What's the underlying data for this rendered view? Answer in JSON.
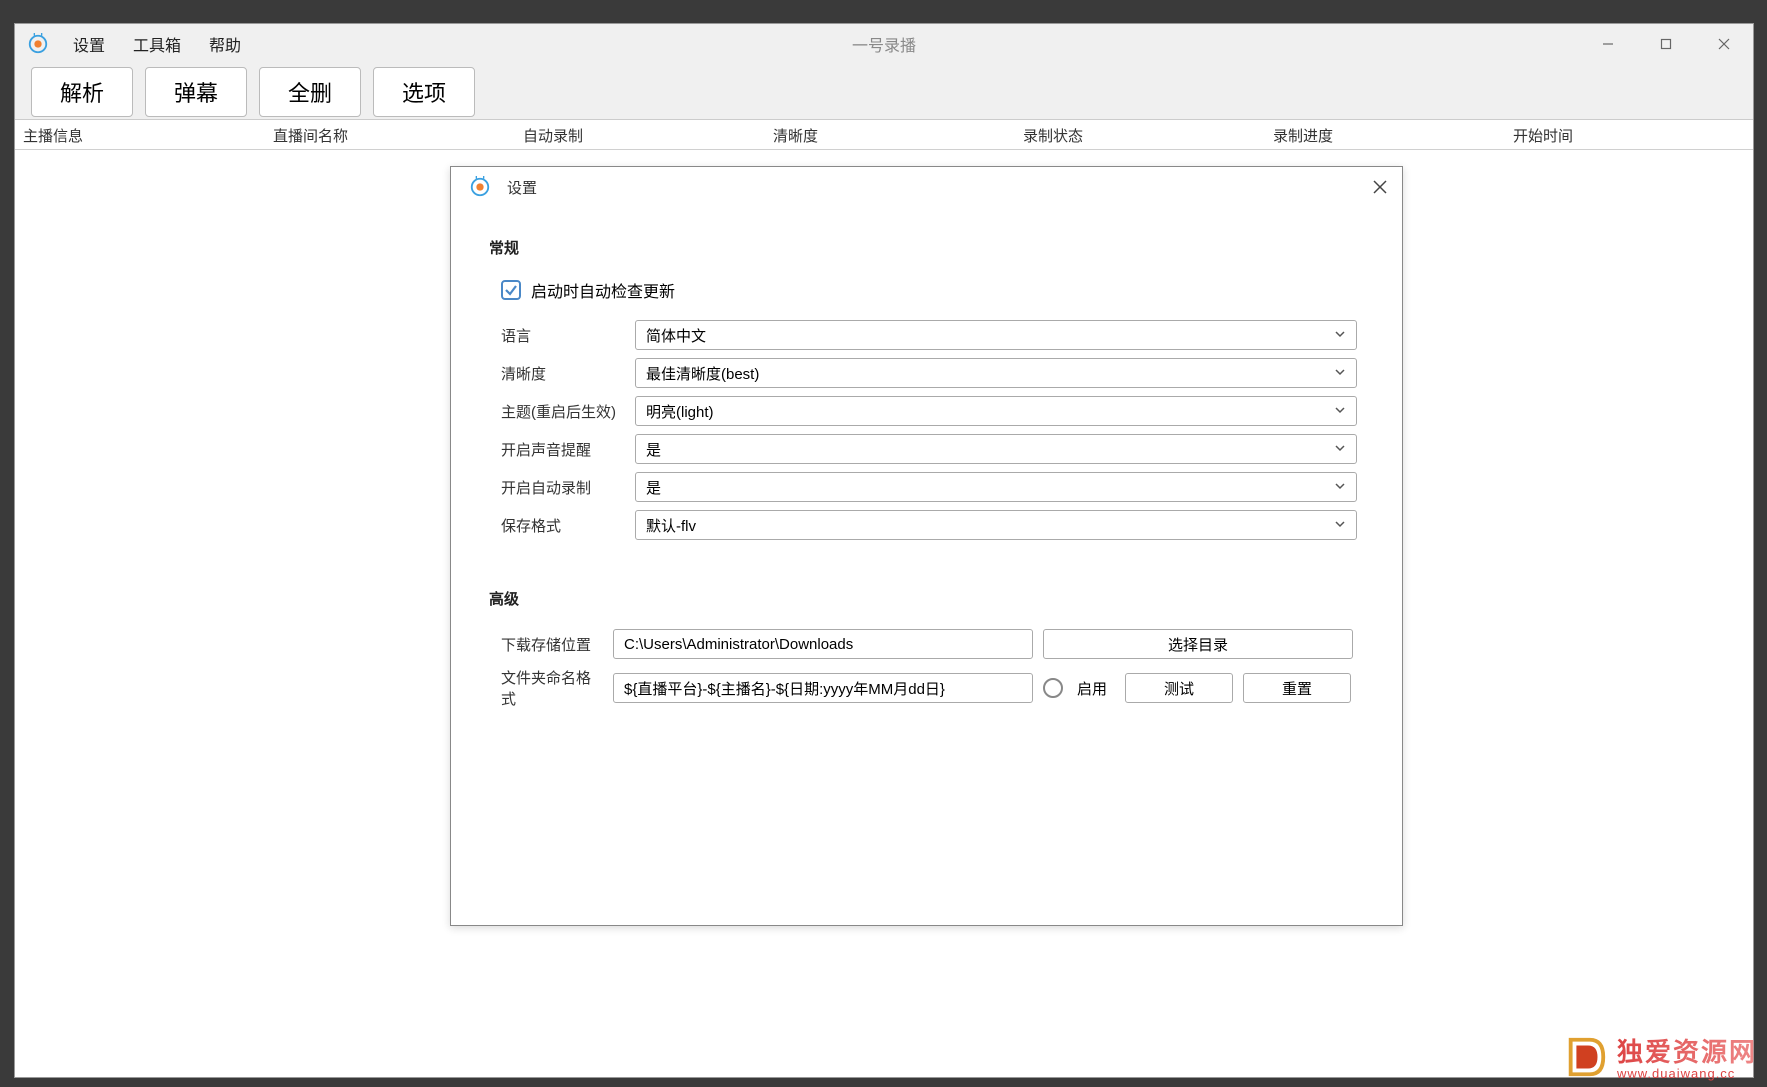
{
  "window": {
    "title": "一号录播",
    "menu": [
      "设置",
      "工具箱",
      "帮助"
    ]
  },
  "toolbar": {
    "buttons": [
      "解析",
      "弹幕",
      "全删",
      "选项"
    ]
  },
  "table": {
    "columns": [
      "主播信息",
      "直播间名称",
      "自动录制",
      "清晰度",
      "录制状态",
      "录制进度",
      "开始时间"
    ]
  },
  "dialog": {
    "title": "设置",
    "sections": {
      "general": {
        "title": "常规",
        "checkbox_label": "启动时自动检查更新",
        "checkbox_checked": true,
        "rows": [
          {
            "label": "语言",
            "value": "简体中文"
          },
          {
            "label": "清晰度",
            "value": "最佳清晰度(best)"
          },
          {
            "label": "主题(重启后生效)",
            "value": "明亮(light)"
          },
          {
            "label": "开启声音提醒",
            "value": "是"
          },
          {
            "label": "开启自动录制",
            "value": "是"
          },
          {
            "label": "保存格式",
            "value": "默认-flv"
          }
        ]
      },
      "advanced": {
        "title": "高级",
        "download_location_label": "下载存储位置",
        "download_location_value": "C:\\Users\\Administrator\\Downloads",
        "choose_dir_button": "选择目录",
        "folder_format_label": "文件夹命名格式",
        "folder_format_value": "${直播平台}-${主播名}-${日期:yyyy年MM月dd日}",
        "enable_radio_label": "启用",
        "test_button": "测试",
        "reset_button": "重置"
      }
    }
  },
  "watermark": {
    "cn": "独爱资源网",
    "en": "www.duaiwang.cc"
  }
}
